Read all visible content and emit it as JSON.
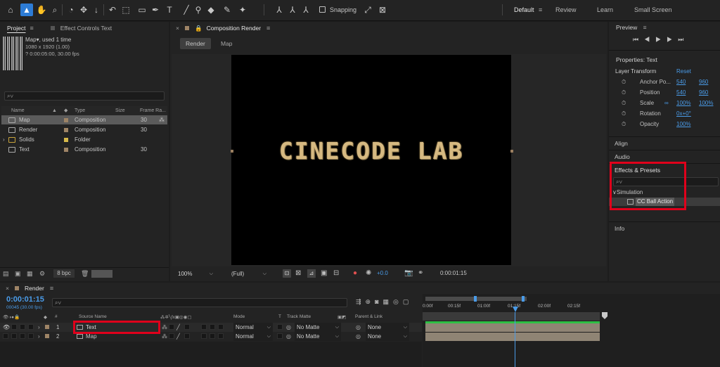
{
  "toolbar": {
    "snapping_label": "Snapping",
    "workspaces": [
      "Default",
      "Review",
      "Learn",
      "Small Screen"
    ],
    "active_workspace": "Default"
  },
  "project_panel": {
    "tab_project": "Project",
    "tab_effect_controls": "Effect Controls Text",
    "thumb_name": "Map",
    "thumb_used": ", used 1 time",
    "thumb_size": "1080 x 1920 (1.00)",
    "thumb_duration": "? 0:00:05:00, 30.00 fps",
    "search_placeholder": "⌕∨",
    "columns": [
      "Name",
      "Type",
      "Size",
      "Frame Ra..."
    ],
    "rows": [
      {
        "name": "Map",
        "type": "Composition",
        "size": "",
        "fps": "30",
        "color": "#9e8466",
        "selected": true
      },
      {
        "name": "Render",
        "type": "Composition",
        "size": "",
        "fps": "30",
        "color": "#9e8466",
        "selected": false
      },
      {
        "name": "Solids",
        "type": "Folder",
        "size": "",
        "fps": "",
        "color": "#d6b84a",
        "selected": false
      },
      {
        "name": "Text",
        "type": "Composition",
        "size": "",
        "fps": "30",
        "color": "#9e8466",
        "selected": false
      }
    ],
    "bpc_label": "8 bpc"
  },
  "comp_panel": {
    "title": "Composition Render",
    "render_tab": "Render",
    "map_tab": "Map",
    "canvas_text": "CINECODE LAB",
    "zoom": "100%",
    "resolution": "(Full)",
    "exposure": "+0.0",
    "timecode": "0:00:01:15"
  },
  "right_panel": {
    "preview_label": "Preview",
    "properties_title": "Properties: Text",
    "layer_transform": "Layer Transform",
    "reset_label": "Reset",
    "properties": [
      {
        "name": "Anchor Po...",
        "v1": "540",
        "v2": "960"
      },
      {
        "name": "Position",
        "v1": "540",
        "v2": "960"
      },
      {
        "name": "Scale",
        "v1": "100%",
        "v2": "100%"
      },
      {
        "name": "Rotation",
        "v1": "0x+0°",
        "v2": ""
      },
      {
        "name": "Opacity",
        "v1": "100%",
        "v2": ""
      }
    ],
    "align_label": "Align",
    "audio_label": "Audio",
    "effects_label": "Effects & Presets",
    "effects_search_placeholder": "⌕∨",
    "simulation_label": "Simulation",
    "effect_item": "CC Ball Action",
    "info_label": "Info"
  },
  "timeline": {
    "tab_label": "Render",
    "timecode": "0:00:01:15",
    "frame_info": "00045 (30.00 fps)",
    "search_placeholder": "⌕∨",
    "col_source": "Source Name",
    "col_mode": "Mode",
    "col_t": "T",
    "col_track": "Track Matte",
    "col_parent": "Parent & Link",
    "ruler": [
      "0:00f",
      "00:15f",
      "01:00f",
      "01:15f",
      "02:00f",
      "02:15f"
    ],
    "layers": [
      {
        "num": "1",
        "name": "Text",
        "mode": "Normal",
        "matte": "No Matte",
        "parent": "None"
      },
      {
        "num": "2",
        "name": "Map",
        "mode": "Normal",
        "matte": "No Matte",
        "parent": "None"
      }
    ]
  },
  "colors": {
    "accent": "#2d7cd6",
    "highlight_red": "#e0001b",
    "timecode_blue": "#4a9be8"
  }
}
